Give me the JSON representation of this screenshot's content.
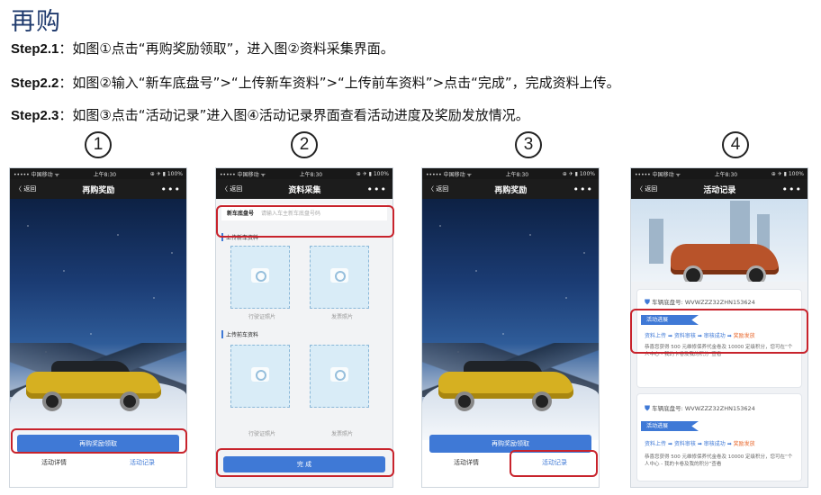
{
  "title": "再购",
  "steps": [
    {
      "label": "Step2.1",
      "text": "：如图①点击“再购奖励领取”，进入图②资料采集界面。"
    },
    {
      "label": "Step2.2",
      "text": "：如图②输入“新车底盘号”>“上传新车资料”>“上传前车资料”>点击“完成”，完成资料上传。"
    },
    {
      "label": "Step2.3",
      "text": "：如图③点击“活动记录”进入图④活动记录界面查看活动进度及奖励发放情况。"
    }
  ],
  "numbers": [
    "1",
    "2",
    "3",
    "4"
  ],
  "status": {
    "carrier": "••••• 中国移动 ᯤ",
    "time": "上午8:30",
    "battery": "⊕ ✈ ▮ 100%"
  },
  "nav": {
    "back": "〈 返回",
    "more": "•••"
  },
  "screen1": {
    "title": "再购奖励",
    "claim_button": "再购奖励领取",
    "tab_details": "活动详情",
    "tab_records": "活动记录"
  },
  "screen2": {
    "title": "资料采集",
    "chassis_label": "新车底盘号",
    "chassis_placeholder": "请输入车主新车底盘号码",
    "section_new": "上传新车资料",
    "section_old": "上传前车资料",
    "caption_license": "行驶证照片",
    "caption_invoice": "发票照片",
    "done_button": "完 成"
  },
  "screen3": {
    "title": "再购奖励",
    "claim_button": "再购奖励领取",
    "tab_details": "活动详情",
    "tab_records": "活动记录"
  },
  "screen4": {
    "title": "活动记录",
    "chassis": "车辆底盘号: WVWZZZ32ZHN153624",
    "progress": "活动进展",
    "flow_1": "资料上传",
    "flow_2": "资料审核",
    "flow_3": "审核成功",
    "flow_4": "奖励发放",
    "arrow": "➡",
    "note": "恭喜您获得 500 元维修保养代金卷及 10000 定级积分，您可在“个人中心 - 我的卡卷及我的积分”查看"
  }
}
